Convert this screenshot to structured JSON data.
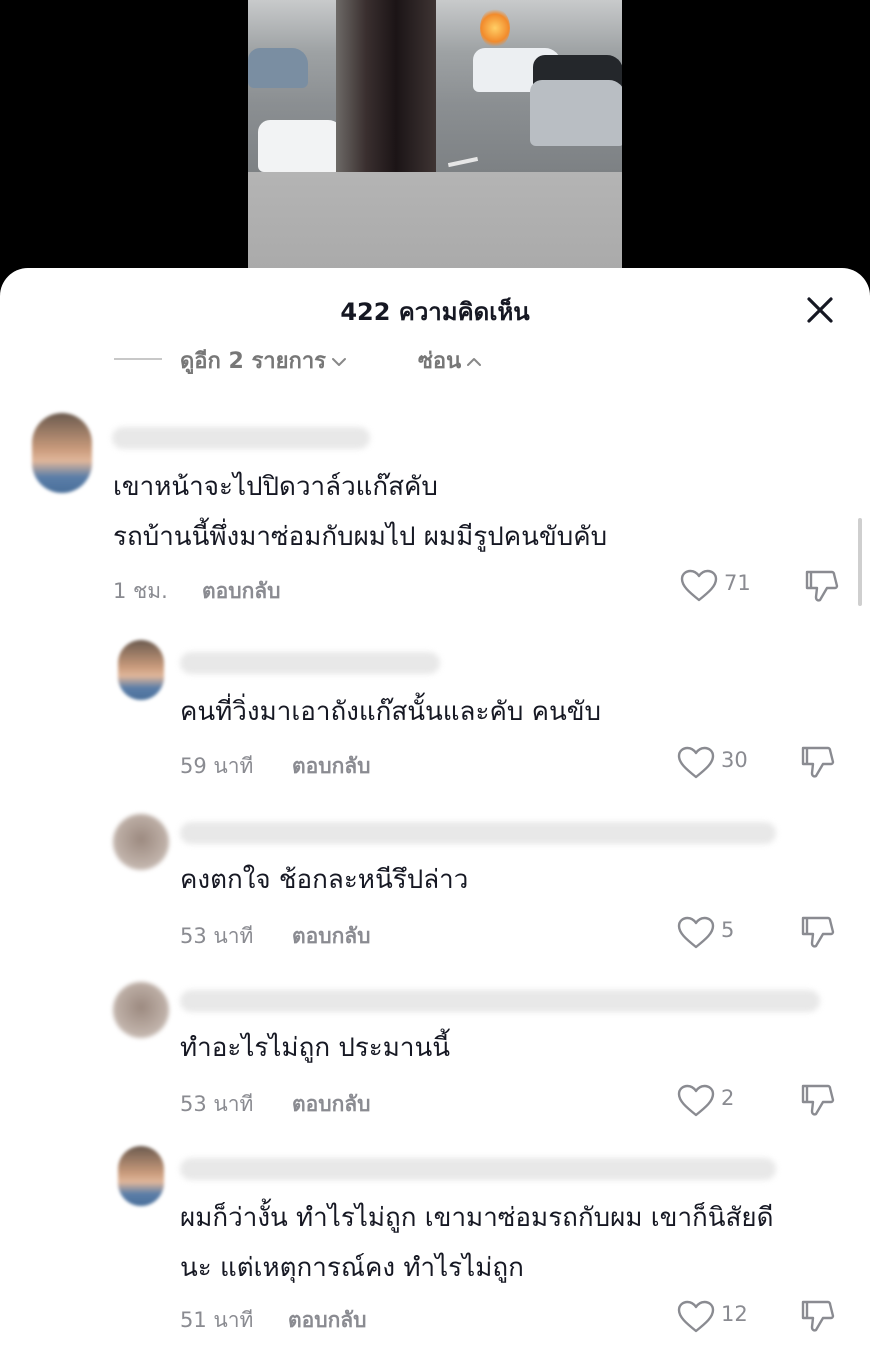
{
  "sheet": {
    "title": "422 ความคิดเห็น"
  },
  "thread": {
    "view_more_label": "ดูอีก 2 รายการ",
    "hide_label": "ซ่อน"
  },
  "comments": [
    {
      "lines": [
        "เขาหน้าจะไปปิดวาล์วแก๊สคับ",
        "รถบ้านนี้พึ่งมาซ่อมกับผมไป ผมมีรูปคนขับคับ"
      ],
      "time": "1 ชม.",
      "reply_label": "ตอบกลับ",
      "likes": "71"
    },
    {
      "lines": [
        "คนที่วิ่งมาเอาถังแก๊สนั้นและคับ คนขับ"
      ],
      "time": "59 นาที",
      "reply_label": "ตอบกลับ",
      "likes": "30"
    },
    {
      "lines": [
        "คงตกใจ ช้อกละหนีรึปล่าว"
      ],
      "time": "53 นาที",
      "reply_label": "ตอบกลับ",
      "likes": "5"
    },
    {
      "lines": [
        "ทำอะไรไม่ถูก ประมานนี้"
      ],
      "time": "53 นาที",
      "reply_label": "ตอบกลับ",
      "likes": "2"
    },
    {
      "lines": [
        "ผมก็ว่างั้น ทำไรไม่ถูก เขามาซ่อมรถกับผม เขาก็นิสัยดี",
        "นะ แต่เหตุการณ์คง ทำไรไม่ถูก"
      ],
      "time": "51 นาที",
      "reply_label": "ตอบกลับ",
      "likes": "12"
    }
  ],
  "icons": {
    "close": "close-icon",
    "like": "heart-outline-icon",
    "dislike": "thumbs-down-icon",
    "chevron_down": "chevron-down-icon",
    "chevron_up": "chevron-up-icon"
  },
  "colors": {
    "text_primary": "#161823",
    "text_secondary": "#8a8b91",
    "sheet_background": "#ffffff",
    "backdrop": "#000000"
  }
}
